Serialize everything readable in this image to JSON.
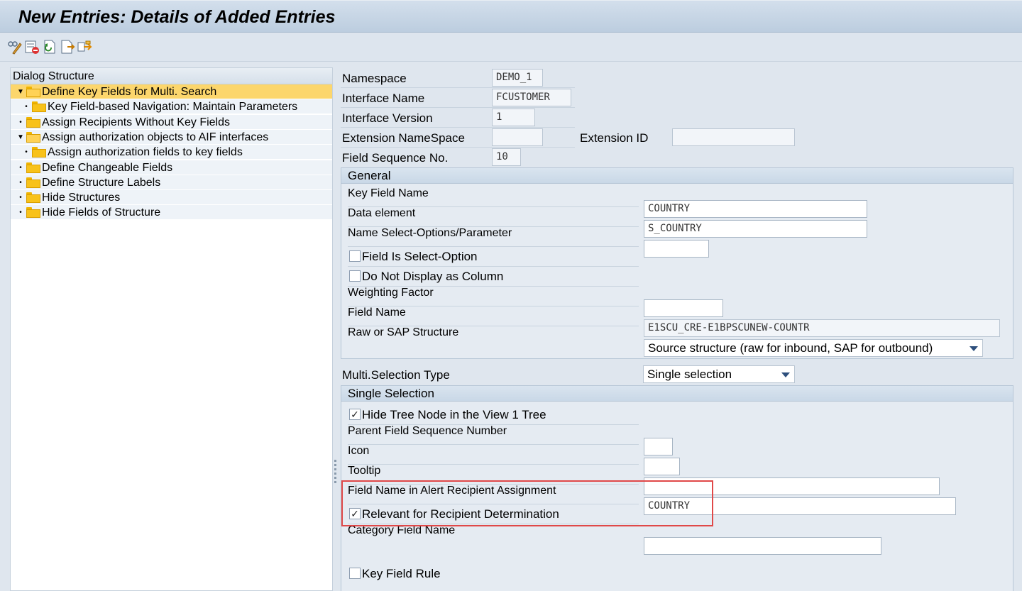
{
  "window": {
    "title": "New Entries: Details of Added Entries"
  },
  "toolbar": {
    "buttons": [
      {
        "icon": "change-display-icon"
      },
      {
        "icon": "delete-row-icon"
      },
      {
        "icon": "undo-change-icon"
      },
      {
        "icon": "previous-entry-icon"
      },
      {
        "icon": "next-entry-icon"
      }
    ]
  },
  "dialog_structure": {
    "title": "Dialog Structure",
    "items": [
      {
        "label": "Define Key Fields for Multi. Search",
        "level": 0,
        "expanded": true,
        "selected": true
      },
      {
        "label": "Key Field-based Navigation: Maintain Parameters",
        "level": 1,
        "expanded": false,
        "selected": false
      },
      {
        "label": "Assign Recipients Without Key Fields",
        "level": 0,
        "expanded": false,
        "selected": false
      },
      {
        "label": "Assign authorization objects to AIF interfaces",
        "level": 0,
        "expanded": true,
        "selected": false
      },
      {
        "label": "Assign authorization fields to key fields",
        "level": 1,
        "expanded": false,
        "selected": false
      },
      {
        "label": "Define Changeable Fields",
        "level": 0,
        "expanded": false,
        "selected": false
      },
      {
        "label": "Define Structure Labels",
        "level": 0,
        "expanded": false,
        "selected": false
      },
      {
        "label": "Hide Structures",
        "level": 0,
        "expanded": false,
        "selected": false
      },
      {
        "label": "Hide Fields of Structure",
        "level": 0,
        "expanded": false,
        "selected": false
      }
    ]
  },
  "header_fields": {
    "namespace": {
      "label": "Namespace",
      "value": "DEMO_1"
    },
    "interface_name": {
      "label": "Interface Name",
      "value": "FCUSTOMER"
    },
    "interface_version": {
      "label": "Interface Version",
      "value": "1"
    },
    "extension_namespace": {
      "label": "Extension NameSpace",
      "value": ""
    },
    "extension_id": {
      "label": "Extension ID",
      "value": ""
    },
    "field_sequence": {
      "label": "Field Sequence No.",
      "value": "10"
    }
  },
  "general": {
    "title": "General",
    "key_field_name": {
      "label": "Key Field Name",
      "value": "COUNTRY"
    },
    "data_element": {
      "label": "Data element",
      "value": "S_COUNTRY"
    },
    "name_select_options": {
      "label": "Name Select-Options/Parameter",
      "value": ""
    },
    "field_is_select_option": {
      "label": "Field Is Select-Option",
      "checked": false
    },
    "do_not_display_as_column": {
      "label": "Do Not Display as Column",
      "checked": false
    },
    "weighting_factor": {
      "label": "Weighting Factor",
      "value": ""
    },
    "field_name": {
      "label": "Field Name",
      "value": "E1SCU_CRE-E1BPSCUNEW-COUNTR"
    },
    "raw_or_sap_structure": {
      "label": "Raw or SAP Structure",
      "value": "Source structure (raw for inbound, SAP for outbound)"
    }
  },
  "multi_selection_type": {
    "label": "Multi.Selection Type",
    "value": "Single selection"
  },
  "single_selection": {
    "title": "Single Selection",
    "hide_tree_node": {
      "label": "Hide Tree Node in the View 1 Tree",
      "checked": true
    },
    "parent_field_sequence": {
      "label": "Parent Field Sequence Number",
      "value": ""
    },
    "icon": {
      "label": "Icon",
      "value": ""
    },
    "tooltip": {
      "label": "Tooltip",
      "value": ""
    },
    "field_name_alert": {
      "label": "Field Name in Alert Recipient Assignment",
      "value": "COUNTRY"
    },
    "relevant_for_recipient": {
      "label": "Relevant for Recipient Determination",
      "checked": true
    },
    "category_field_name": {
      "label": "Category Field Name",
      "value": ""
    },
    "key_field_rule": {
      "label": "Key Field Rule",
      "checked": false
    }
  },
  "colors": {
    "selected_tree_row": "#fcd66c",
    "highlight_box": "#e04848",
    "folder": "#f8c21a"
  }
}
